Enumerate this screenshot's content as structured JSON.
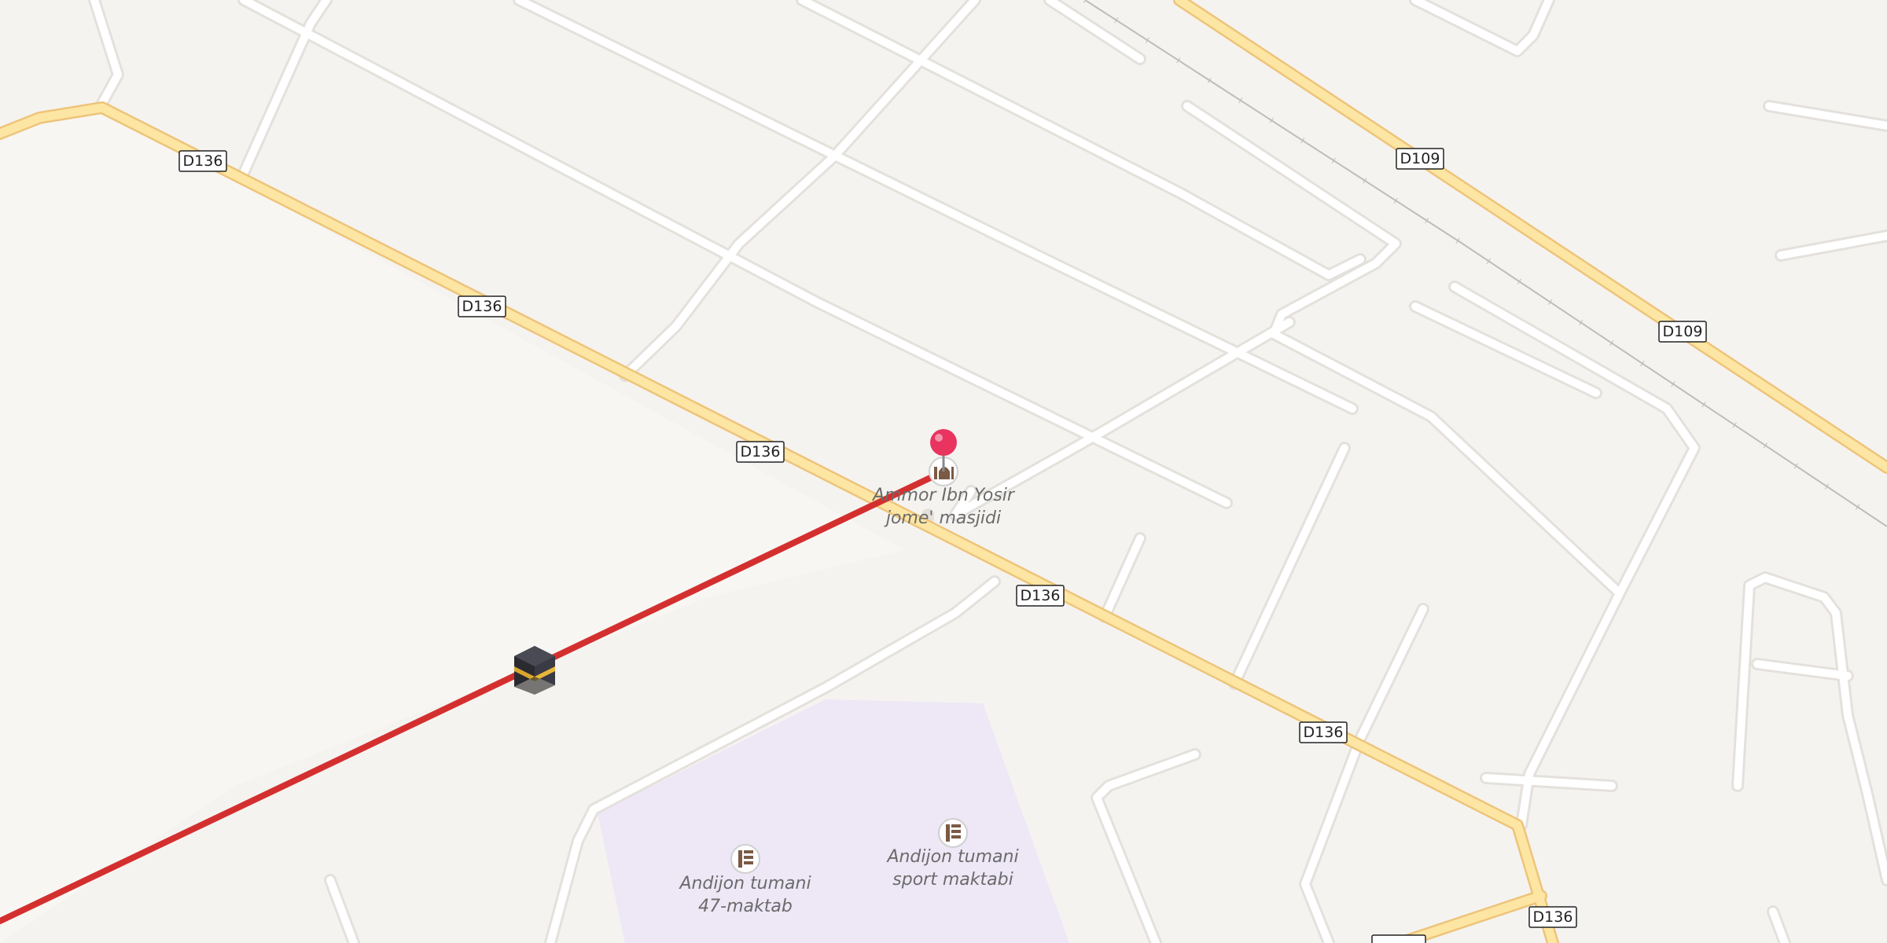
{
  "map": {
    "road_labels": [
      "D136",
      "D136",
      "D136",
      "D136",
      "D109",
      "D109",
      "D136",
      "D136"
    ],
    "pois": [
      {
        "name_line1": "Ammor Ibn Yosir",
        "name_line2": "jome' masjidi",
        "icon": "mosque-icon"
      },
      {
        "name_line1": "Andijon tumani",
        "name_line2": "47-maktab",
        "icon": "school-icon"
      },
      {
        "name_line1": "Andijon tumani",
        "name_line2": "sport maktabi",
        "icon": "school-icon"
      }
    ],
    "markers": {
      "selected_pin": "red-location-pin",
      "qibla_marker": "kaaba-icon"
    },
    "colors": {
      "background": "#f5f3f0",
      "minor_road": "#ffffff",
      "main_road": "#fde6a3",
      "main_road_casing": "#eec47a",
      "qibla_line": "#d42f2f",
      "school_area": "#ede7f6",
      "pin": "#e8345f"
    }
  }
}
